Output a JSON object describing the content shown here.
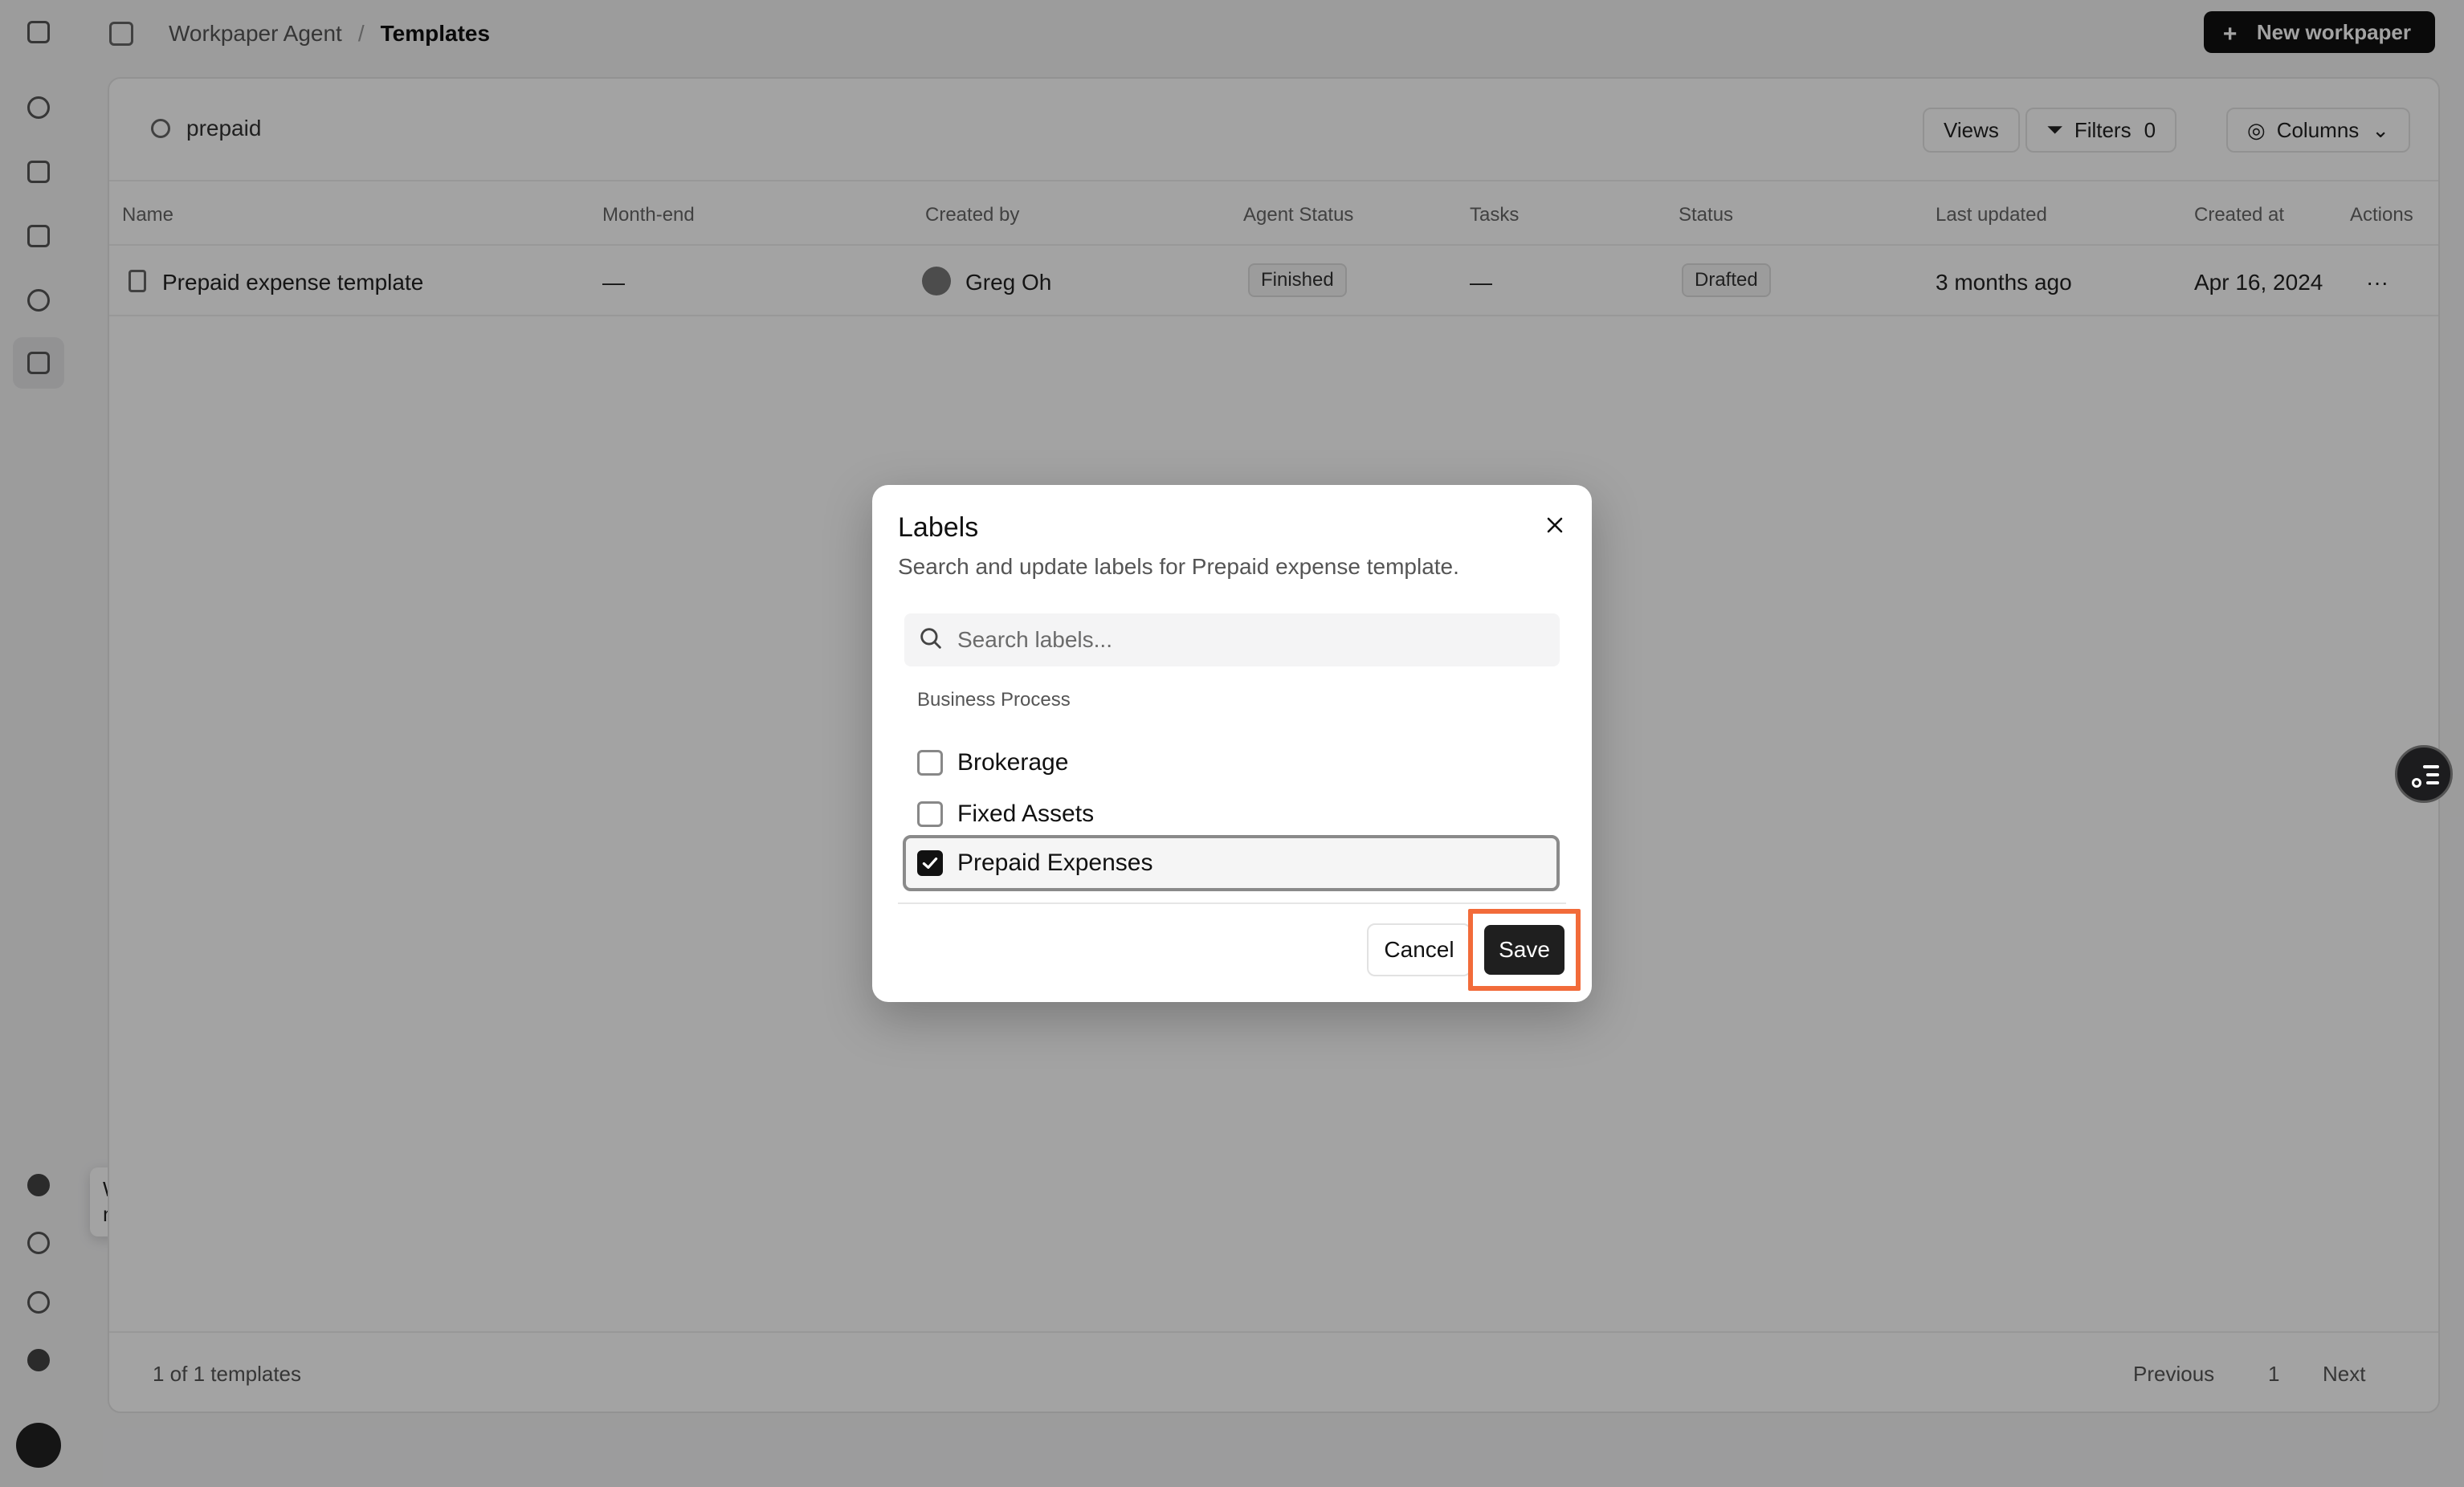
{
  "app": {
    "breadcrumb": [
      "Workpaper Agent",
      "Templates"
    ],
    "new_button_label": "New workpaper",
    "tooltip": "What's new"
  },
  "toolbar": {
    "search_value": "prepaid",
    "views_label": "Views",
    "filters_label": "Filters",
    "filters_count": "0",
    "columns_label": "Columns"
  },
  "table": {
    "columns": [
      "Name",
      "Month-end",
      "Created by",
      "Agent Status",
      "Tasks",
      "Status",
      "Last updated",
      "Created at",
      "Actions"
    ],
    "rows": [
      {
        "name": "Prepaid expense template",
        "month_end": "—",
        "created_by": "Greg Oh",
        "agent_status": "Finished",
        "tasks": "—",
        "status": "Drafted",
        "last_updated": "3 months ago",
        "created_at": "Apr 16, 2024",
        "actions": "···"
      }
    ]
  },
  "footer": {
    "count": "1 of 1 templates",
    "previous": "Previous",
    "page": "1",
    "next": "Next"
  },
  "modal": {
    "title": "Labels",
    "description": "Search and update labels for Prepaid expense template.",
    "search_placeholder": "Search labels...",
    "group": "Business Process",
    "options": [
      {
        "label": "Brokerage",
        "checked": false
      },
      {
        "label": "Fixed Assets",
        "checked": false
      },
      {
        "label": "Prepaid Expenses",
        "checked": true
      }
    ],
    "cancel_label": "Cancel",
    "save_label": "Save",
    "highlight_color": "#f26b3a"
  }
}
